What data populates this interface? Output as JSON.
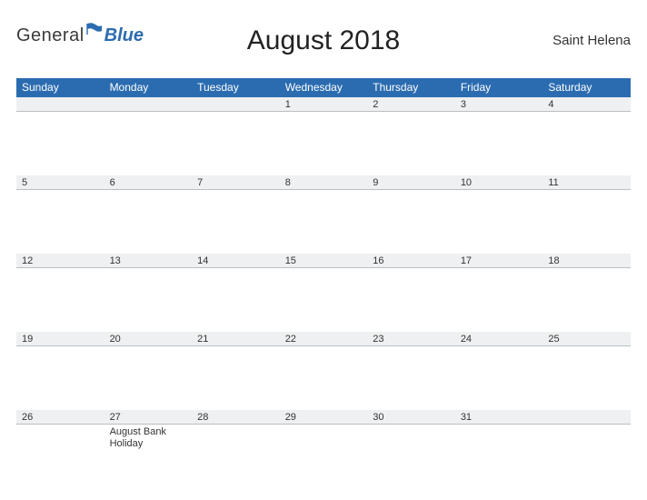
{
  "logo": {
    "general": "General",
    "blue": "Blue"
  },
  "title": "August 2018",
  "region": "Saint Helena",
  "weekdays": [
    "Sunday",
    "Monday",
    "Tuesday",
    "Wednesday",
    "Thursday",
    "Friday",
    "Saturday"
  ],
  "grid": [
    [
      {
        "date": "",
        "event": ""
      },
      {
        "date": "",
        "event": ""
      },
      {
        "date": "",
        "event": ""
      },
      {
        "date": "1",
        "event": ""
      },
      {
        "date": "2",
        "event": ""
      },
      {
        "date": "3",
        "event": ""
      },
      {
        "date": "4",
        "event": ""
      }
    ],
    [
      {
        "date": "5",
        "event": ""
      },
      {
        "date": "6",
        "event": ""
      },
      {
        "date": "7",
        "event": ""
      },
      {
        "date": "8",
        "event": ""
      },
      {
        "date": "9",
        "event": ""
      },
      {
        "date": "10",
        "event": ""
      },
      {
        "date": "11",
        "event": ""
      }
    ],
    [
      {
        "date": "12",
        "event": ""
      },
      {
        "date": "13",
        "event": ""
      },
      {
        "date": "14",
        "event": ""
      },
      {
        "date": "15",
        "event": ""
      },
      {
        "date": "16",
        "event": ""
      },
      {
        "date": "17",
        "event": ""
      },
      {
        "date": "18",
        "event": ""
      }
    ],
    [
      {
        "date": "19",
        "event": ""
      },
      {
        "date": "20",
        "event": ""
      },
      {
        "date": "21",
        "event": ""
      },
      {
        "date": "22",
        "event": ""
      },
      {
        "date": "23",
        "event": ""
      },
      {
        "date": "24",
        "event": ""
      },
      {
        "date": "25",
        "event": ""
      }
    ],
    [
      {
        "date": "26",
        "event": ""
      },
      {
        "date": "27",
        "event": "August Bank Holiday"
      },
      {
        "date": "28",
        "event": ""
      },
      {
        "date": "29",
        "event": ""
      },
      {
        "date": "30",
        "event": ""
      },
      {
        "date": "31",
        "event": ""
      },
      {
        "date": "",
        "event": ""
      }
    ]
  ]
}
